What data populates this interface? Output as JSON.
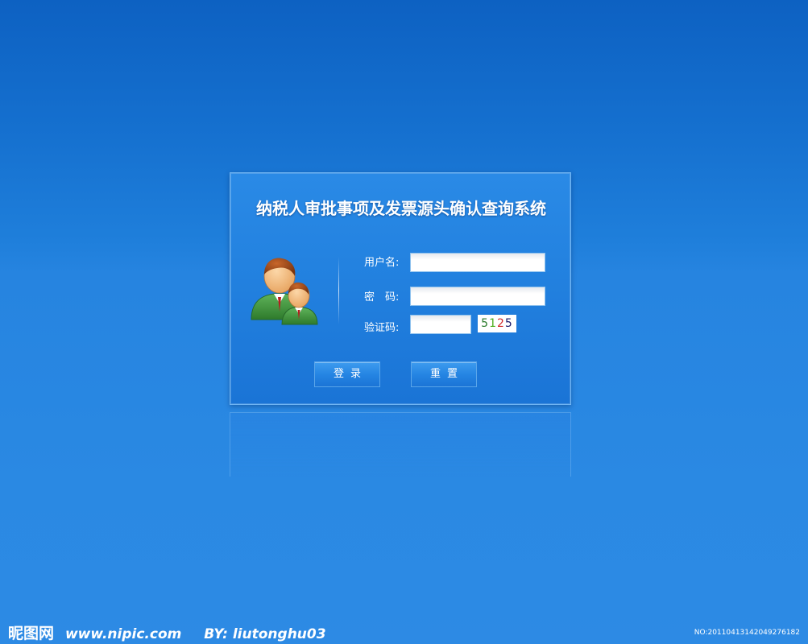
{
  "login": {
    "title": "纳税人审批事项及发票源头确认查询系统",
    "username_label": "用户名:",
    "password_label": "密　码:",
    "captcha_label": "验证码:",
    "username_value": "",
    "password_value": "",
    "captcha_value": "",
    "captcha_digits": [
      {
        "char": "5",
        "color": "#2a7a2a"
      },
      {
        "char": "1",
        "color": "#4cae1c"
      },
      {
        "char": "2",
        "color": "#d22a2a"
      },
      {
        "char": "5",
        "color": "#1a1a6a"
      }
    ],
    "login_button": "登录",
    "reset_button": "重置",
    "avatar_icon": "users-icon"
  },
  "watermark": {
    "brand": "昵图网",
    "url": "www.nipic.com",
    "author": "BY: liutonghu03",
    "serial": "NO:20110413142049276182"
  },
  "colors": {
    "background_top": "#0d61c2",
    "background_bottom": "#2d8ae4",
    "panel": "#2382e0"
  }
}
